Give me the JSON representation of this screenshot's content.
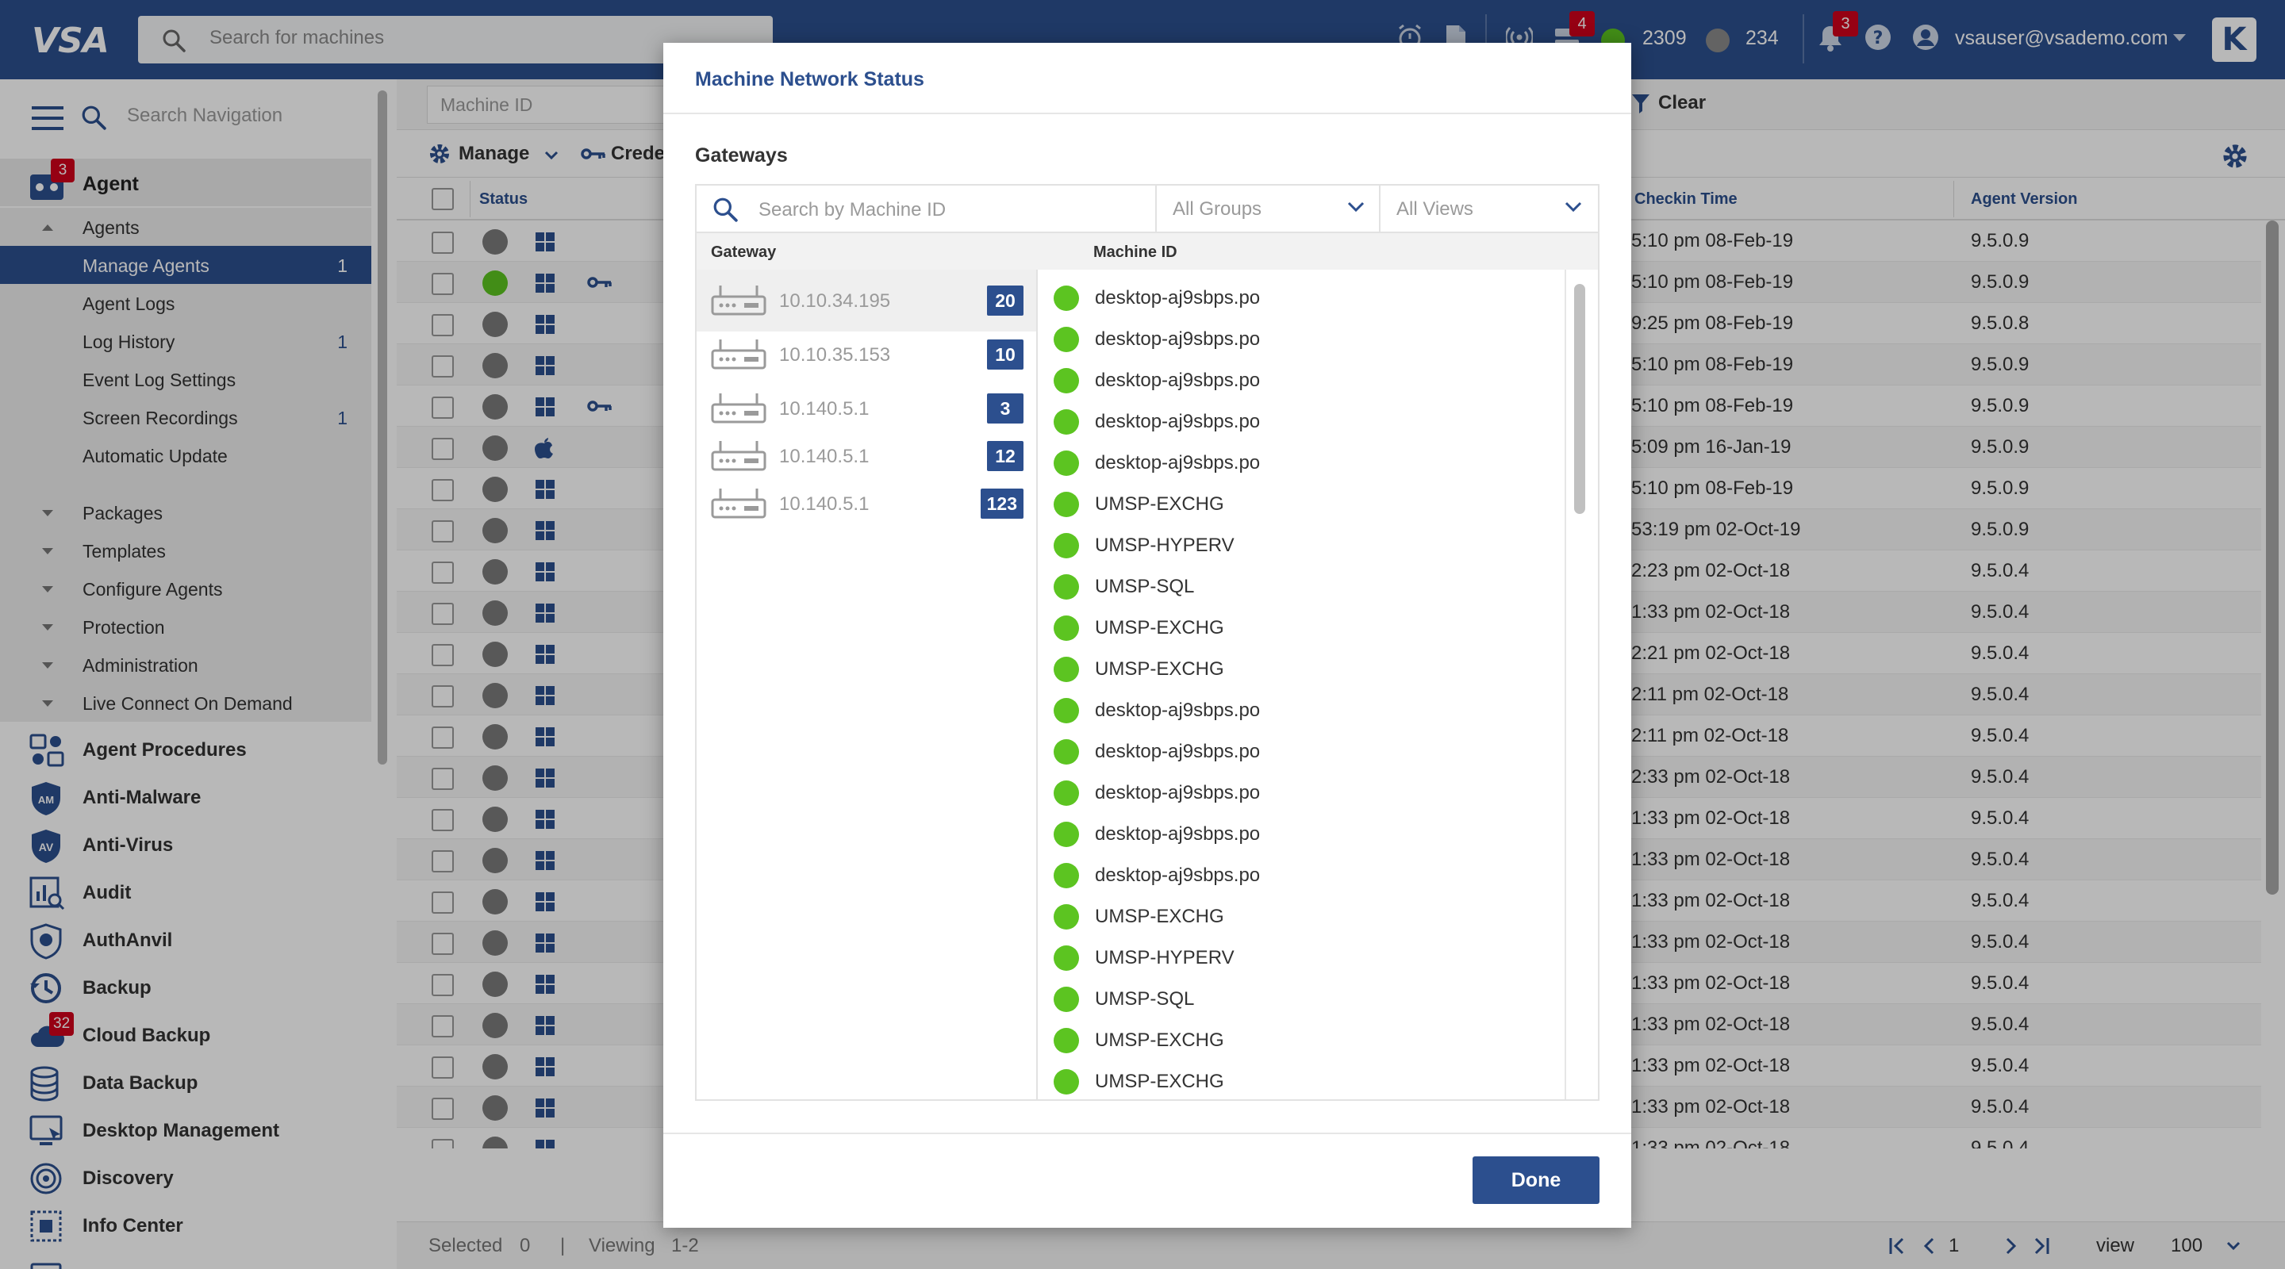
{
  "topbar": {
    "logo": "VSA",
    "search_placeholder": "Search for machines",
    "alerts_badge": "4",
    "online_count": "2309",
    "offline_count": "234",
    "notifications_badge": "3",
    "user": "vsauser@vsademo.com",
    "colors": {
      "bar": "#2c4f8e",
      "online": "#5cc421",
      "offline": "#8a8a8a",
      "badge": "#d0021b"
    }
  },
  "sidebar": {
    "search_placeholder": "Search Navigation",
    "agent_module": {
      "label": "Agent",
      "badge": "3"
    },
    "agents_group": {
      "label": "Agents",
      "items": [
        {
          "label": "Manage Agents",
          "count": "1",
          "selected": true
        },
        {
          "label": "Agent Logs",
          "count": ""
        },
        {
          "label": "Log History",
          "count": "1"
        },
        {
          "label": "Event Log Settings",
          "count": ""
        },
        {
          "label": "Screen Recordings",
          "count": "1"
        },
        {
          "label": "Automatic Update",
          "count": ""
        }
      ]
    },
    "groups": [
      {
        "label": "Packages"
      },
      {
        "label": "Templates"
      },
      {
        "label": "Configure Agents"
      },
      {
        "label": "Protection"
      },
      {
        "label": "Administration"
      },
      {
        "label": "Live Connect On Demand"
      }
    ],
    "modules": [
      {
        "label": "Agent Procedures",
        "icon": "agent-procedures-icon",
        "badge": ""
      },
      {
        "label": "Anti-Malware",
        "icon": "anti-malware-icon",
        "badge": ""
      },
      {
        "label": "Anti-Virus",
        "icon": "anti-virus-icon",
        "badge": ""
      },
      {
        "label": "Audit",
        "icon": "audit-icon",
        "badge": ""
      },
      {
        "label": "AuthAnvil",
        "icon": "authanvil-icon",
        "badge": ""
      },
      {
        "label": "Backup",
        "icon": "backup-icon",
        "badge": ""
      },
      {
        "label": "Cloud Backup",
        "icon": "cloud-backup-icon",
        "badge": "32"
      },
      {
        "label": "Data Backup",
        "icon": "data-backup-icon",
        "badge": ""
      },
      {
        "label": "Desktop Management",
        "icon": "desktop-management-icon",
        "badge": ""
      },
      {
        "label": "Discovery",
        "icon": "discovery-icon",
        "badge": ""
      },
      {
        "label": "Info Center",
        "icon": "info-center-icon",
        "badge": ""
      }
    ]
  },
  "main": {
    "machine_id_placeholder": "Machine ID",
    "clear_label": "Clear",
    "manage_label": "Manage",
    "credentials_label": "Crede",
    "columns": {
      "status": "Status",
      "checkin": "Checkin Time",
      "agent_version": "Agent Version"
    },
    "rows": [
      {
        "online": false,
        "os": "windows",
        "key": false,
        "checkin": "5:10 pm 08-Feb-19",
        "version": "9.5.0.9"
      },
      {
        "online": true,
        "os": "windows",
        "key": true,
        "checkin": "5:10 pm 08-Feb-19",
        "version": "9.5.0.9"
      },
      {
        "online": false,
        "os": "windows",
        "key": false,
        "checkin": "9:25 pm 08-Feb-19",
        "version": "9.5.0.8"
      },
      {
        "online": false,
        "os": "windows",
        "key": false,
        "checkin": "5:10 pm 08-Feb-19",
        "version": "9.5.0.9"
      },
      {
        "online": false,
        "os": "windows",
        "key": true,
        "checkin": "5:10 pm 08-Feb-19",
        "version": "9.5.0.9"
      },
      {
        "online": false,
        "os": "apple",
        "key": false,
        "checkin": "5:09 pm 16-Jan-19",
        "version": "9.5.0.9"
      },
      {
        "online": false,
        "os": "windows",
        "key": false,
        "checkin": "5:10 pm 08-Feb-19",
        "version": "9.5.0.9"
      },
      {
        "online": false,
        "os": "windows",
        "key": false,
        "checkin": "53:19 pm 02-Oct-19",
        "version": "9.5.0.9"
      },
      {
        "online": false,
        "os": "windows",
        "key": false,
        "checkin": "2:23 pm 02-Oct-18",
        "version": "9.5.0.4"
      },
      {
        "online": false,
        "os": "windows",
        "key": false,
        "checkin": "1:33 pm 02-Oct-18",
        "version": "9.5.0.4"
      },
      {
        "online": false,
        "os": "windows",
        "key": false,
        "checkin": "2:21 pm 02-Oct-18",
        "version": "9.5.0.4"
      },
      {
        "online": false,
        "os": "windows",
        "key": false,
        "checkin": "2:11 pm 02-Oct-18",
        "version": "9.5.0.4"
      },
      {
        "online": false,
        "os": "windows",
        "key": false,
        "checkin": "2:11 pm 02-Oct-18",
        "version": "9.5.0.4"
      },
      {
        "online": false,
        "os": "windows",
        "key": false,
        "checkin": "2:33 pm 02-Oct-18",
        "version": "9.5.0.4"
      },
      {
        "online": false,
        "os": "windows",
        "key": false,
        "checkin": "1:33 pm 02-Oct-18",
        "version": "9.5.0.4"
      },
      {
        "online": false,
        "os": "windows",
        "key": false,
        "checkin": "1:33 pm 02-Oct-18",
        "version": "9.5.0.4"
      },
      {
        "online": false,
        "os": "windows",
        "key": false,
        "checkin": "1:33 pm 02-Oct-18",
        "version": "9.5.0.4"
      },
      {
        "online": false,
        "os": "windows",
        "key": false,
        "checkin": "1:33 pm 02-Oct-18",
        "version": "9.5.0.4"
      },
      {
        "online": false,
        "os": "windows",
        "key": false,
        "checkin": "1:33 pm 02-Oct-18",
        "version": "9.5.0.4"
      },
      {
        "online": false,
        "os": "windows",
        "key": false,
        "checkin": "1:33 pm 02-Oct-18",
        "version": "9.5.0.4"
      },
      {
        "online": false,
        "os": "windows",
        "key": false,
        "checkin": "1:33 pm 02-Oct-18",
        "version": "9.5.0.4"
      },
      {
        "online": false,
        "os": "windows",
        "key": false,
        "checkin": "1:33 pm 02-Oct-18",
        "version": "9.5.0.4"
      },
      {
        "online": false,
        "os": "windows",
        "key": false,
        "checkin": "1:33 pm 02-Oct-18",
        "version": "9.5.0.4"
      }
    ],
    "footer": {
      "selected_label": "Selected",
      "selected_value": "0",
      "viewing_label": "Viewing",
      "viewing_value": "1-2",
      "page": "1",
      "view_label": "view",
      "page_size": "100"
    }
  },
  "modal": {
    "title": "Machine Network Status",
    "section": "Gateways",
    "search_placeholder": "Search by Machine ID",
    "groups_select": "All Groups",
    "views_select": "All Views",
    "col_gateway": "Gateway",
    "col_machine": "Machine ID",
    "gateways": [
      {
        "ip": "10.10.34.195",
        "count": "20",
        "selected": true
      },
      {
        "ip": "10.10.35.153",
        "count": "10"
      },
      {
        "ip": "10.140.5.1",
        "count": "3"
      },
      {
        "ip": "10.140.5.1",
        "count": "12"
      },
      {
        "ip": "10.140.5.1",
        "count": "123"
      }
    ],
    "machines": [
      "desktop-aj9sbps.po",
      "desktop-aj9sbps.po",
      "desktop-aj9sbps.po",
      "desktop-aj9sbps.po",
      "desktop-aj9sbps.po",
      "UMSP-EXCHG",
      "UMSP-HYPERV",
      "UMSP-SQL",
      "UMSP-EXCHG",
      "UMSP-EXCHG",
      "desktop-aj9sbps.po",
      "desktop-aj9sbps.po",
      "desktop-aj9sbps.po",
      "desktop-aj9sbps.po",
      "desktop-aj9sbps.po",
      "UMSP-EXCHG",
      "UMSP-HYPERV",
      "UMSP-SQL",
      "UMSP-EXCHG",
      "UMSP-EXCHG"
    ],
    "done_label": "Done"
  }
}
